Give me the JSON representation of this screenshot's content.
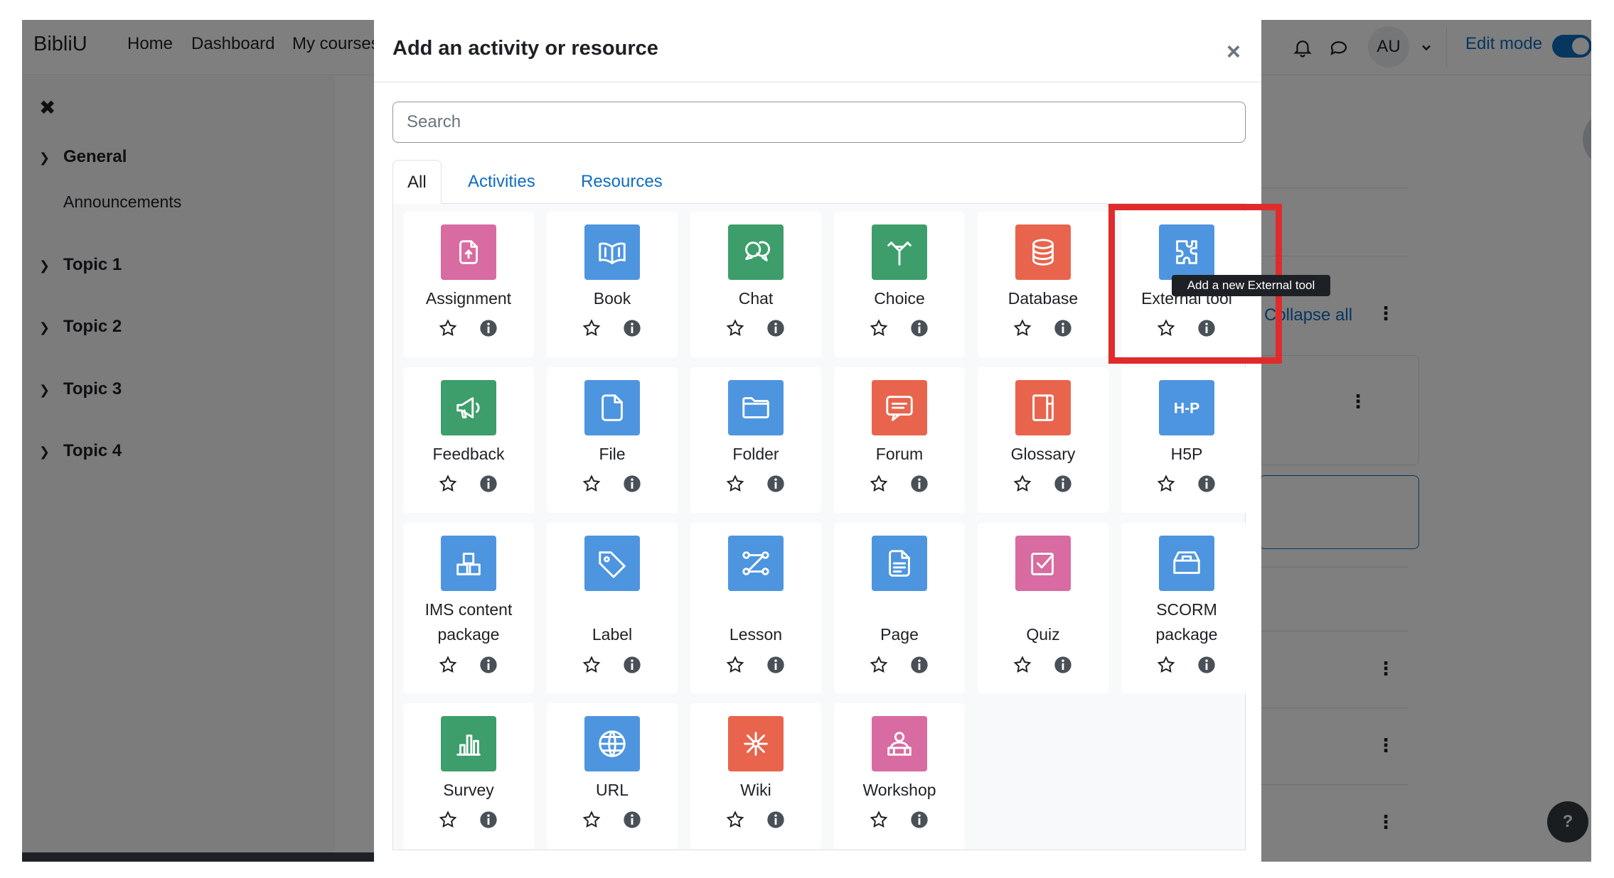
{
  "navbar": {
    "brand": "BibliU",
    "links": [
      "Home",
      "Dashboard",
      "My courses"
    ],
    "avatar_initials": "AU",
    "edit_mode_label": "Edit mode"
  },
  "drawer": {
    "sections": [
      {
        "label": "General",
        "items": [
          "Announcements"
        ]
      },
      {
        "label": "Topic 1",
        "items": []
      },
      {
        "label": "Topic 2",
        "items": []
      },
      {
        "label": "Topic 3",
        "items": []
      },
      {
        "label": "Topic 4",
        "items": []
      }
    ]
  },
  "page": {
    "collapse_all": "Collapse all",
    "help": "?"
  },
  "modal": {
    "title": "Add an activity or resource",
    "search_placeholder": "Search",
    "tabs": [
      "All",
      "Activities",
      "Resources"
    ],
    "items": [
      {
        "label": "Assignment",
        "icon": "assignment-icon",
        "color": "#d86ba1"
      },
      {
        "label": "Book",
        "icon": "book-icon",
        "color": "#4e95e0"
      },
      {
        "label": "Chat",
        "icon": "chat-icon",
        "color": "#3d9e6b"
      },
      {
        "label": "Choice",
        "icon": "choice-icon",
        "color": "#3d9e6b"
      },
      {
        "label": "Database",
        "icon": "database-icon",
        "color": "#e8644d"
      },
      {
        "label": "External tool",
        "icon": "puzzle-icon",
        "color": "#4e95e0"
      },
      {
        "label": "Feedback",
        "icon": "megaphone-icon",
        "color": "#3d9e6b"
      },
      {
        "label": "File",
        "icon": "file-icon",
        "color": "#4e95e0"
      },
      {
        "label": "Folder",
        "icon": "folder-icon",
        "color": "#4e95e0"
      },
      {
        "label": "Forum",
        "icon": "forum-icon",
        "color": "#e8644d"
      },
      {
        "label": "Glossary",
        "icon": "glossary-icon",
        "color": "#e8644d"
      },
      {
        "label": "H5P",
        "icon": "h5p-icon",
        "color": "#4e95e0"
      },
      {
        "label": "IMS content package",
        "icon": "ims-icon",
        "color": "#4e95e0"
      },
      {
        "label": "Label",
        "icon": "tag-icon",
        "color": "#4e95e0"
      },
      {
        "label": "Lesson",
        "icon": "lesson-icon",
        "color": "#4e95e0"
      },
      {
        "label": "Page",
        "icon": "page-icon",
        "color": "#4e95e0"
      },
      {
        "label": "Quiz",
        "icon": "quiz-icon",
        "color": "#d86ba1"
      },
      {
        "label": "SCORM package",
        "icon": "scorm-icon",
        "color": "#4e95e0"
      },
      {
        "label": "Survey",
        "icon": "bar-chart-icon",
        "color": "#3d9e6b"
      },
      {
        "label": "URL",
        "icon": "globe-icon",
        "color": "#4e95e0"
      },
      {
        "label": "Wiki",
        "icon": "wiki-icon",
        "color": "#e8644d"
      },
      {
        "label": "Workshop",
        "icon": "workshop-icon",
        "color": "#d86ba1"
      }
    ],
    "tooltip": "Add a new External tool"
  }
}
